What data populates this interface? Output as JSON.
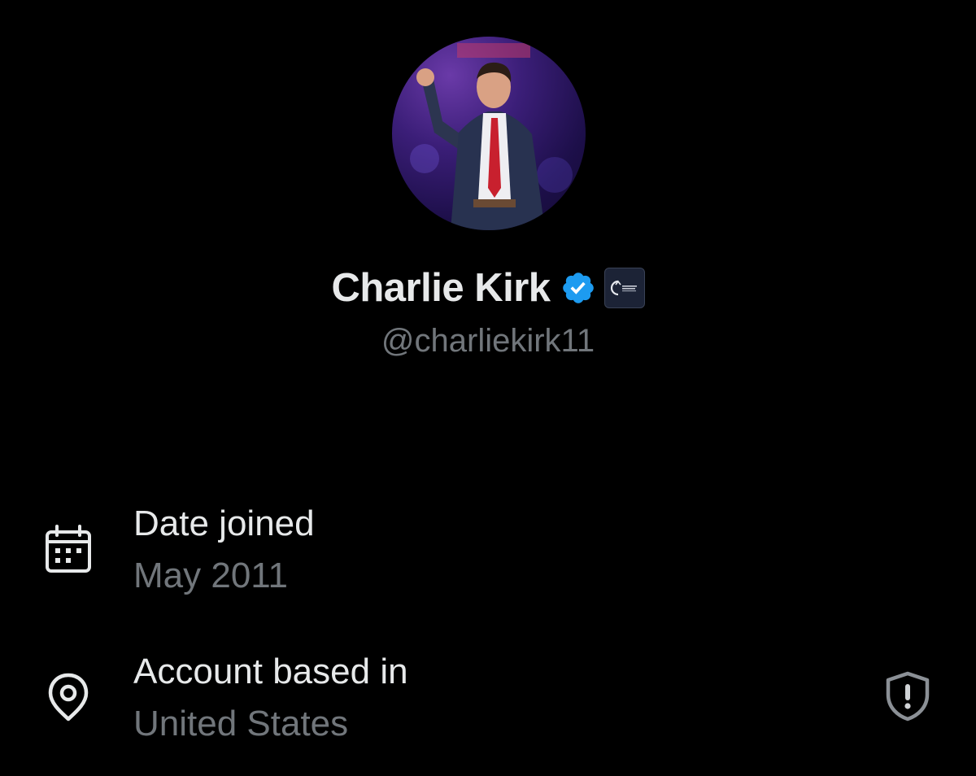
{
  "profile": {
    "display_name": "Charlie Kirk",
    "handle": "@charliekirk11",
    "verified_icon": "verified-badge-icon",
    "affiliate_badge_icon": "affiliate-org-badge-icon",
    "verified_color": "#1d9bf0"
  },
  "about": {
    "items": [
      {
        "icon": "calendar-icon",
        "title": "Date joined",
        "value": "May 2011"
      },
      {
        "icon": "location-pin-icon",
        "title": "Account based in",
        "value": "United States",
        "trailing_icon": "shield-alert-icon"
      }
    ]
  },
  "colors": {
    "background": "#000000",
    "primary_text": "#e7e9ea",
    "secondary_text": "#71767b"
  }
}
